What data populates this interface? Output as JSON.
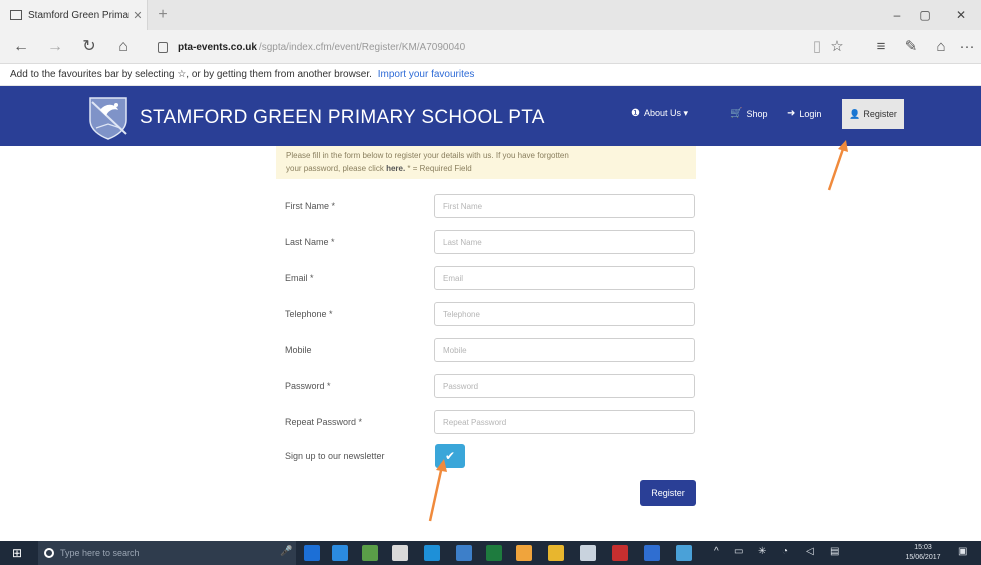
{
  "browser": {
    "tab_title": "Stamford Green Primary",
    "tab_close": "✕",
    "new_tab": "+",
    "window_controls": {
      "minimize": "–",
      "maximize": "▢",
      "close": "✕"
    },
    "url_host": "pta-events.co.uk",
    "url_path": "/sgpta/index.cfm/event/Register/KM/A7090040",
    "nav_icons": [
      "back-arrow-icon",
      "forward-arrow-icon",
      "refresh-icon",
      "home-icon"
    ],
    "toolbar_icons": [
      "reading-view-icon",
      "favourites-star-icon",
      "hub-icon",
      "web-note-icon",
      "share-icon",
      "more-icon"
    ],
    "more_label": "···",
    "favourites_hint": "Add to the favourites bar by selecting ☆, or by getting them from another browser.",
    "favourites_link": "Import your favourites"
  },
  "site": {
    "name": "STAMFORD GREEN PRIMARY SCHOOL PTA",
    "menu": {
      "about": "About Us ▾",
      "shop": "Shop",
      "login": "Login",
      "register": "Register"
    },
    "brand_color": "#2a3f96"
  },
  "form": {
    "notice_line1": "Please fill in the form below to register your details with us. If you have forgotten",
    "notice_line2_prefix": "your password, please click",
    "notice_link": "here.",
    "notice_line2_suffix": " * = Required Field",
    "fields": [
      {
        "label": "First Name *",
        "placeholder": "First Name"
      },
      {
        "label": "Last Name *",
        "placeholder": "Last Name"
      },
      {
        "label": "Email *",
        "placeholder": "Email"
      },
      {
        "label": "Telephone *",
        "placeholder": "Telephone"
      },
      {
        "label": "Mobile",
        "placeholder": "Mobile"
      },
      {
        "label": "Password *",
        "placeholder": "Password"
      },
      {
        "label": "Repeat Password *",
        "placeholder": "Repeat Password"
      }
    ],
    "newsletter_label": "Sign up to our newsletter",
    "submit_label": "Register"
  },
  "annotation": {
    "arrow_color": "#f08a3c"
  },
  "taskbar": {
    "search_placeholder": "Type here to search",
    "clock_time": "15:03",
    "clock_date": "15/06/2017"
  }
}
